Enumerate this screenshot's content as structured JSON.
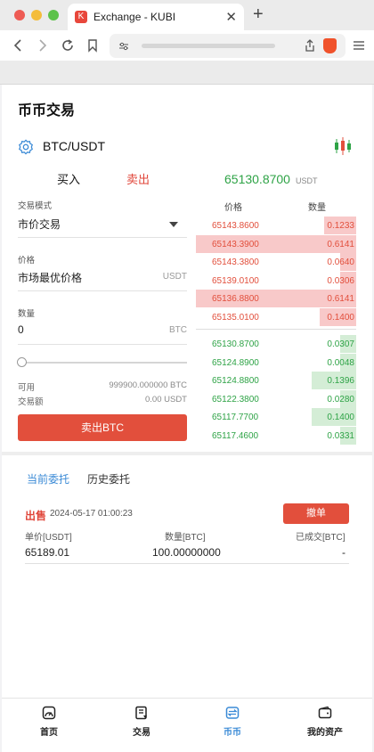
{
  "browser": {
    "tab_title": "Exchange - KUBI",
    "tab_close": "✕",
    "new_tab": "+"
  },
  "page": {
    "title": "币币交易",
    "pair": "BTC/USDT",
    "buy_tab": "买入",
    "sell_tab": "卖出"
  },
  "form": {
    "mode_label": "交易模式",
    "mode_value": "市价交易",
    "price_label": "价格",
    "price_value": "市场最优价格",
    "price_unit": "USDT",
    "qty_label": "数量",
    "qty_value": "0",
    "qty_unit": "BTC",
    "slider_percent": 0,
    "available_label": "可用",
    "available_value": "999900.000000 BTC",
    "volume_label": "交易额",
    "volume_value": "0.00 USDT",
    "sell_button": "卖出BTC"
  },
  "orderbook": {
    "last_price": "65130.8700",
    "last_unit": "USDT",
    "price_header": "价格",
    "qty_header": "数量",
    "asks": [
      {
        "price": "65143.8600",
        "qty": "0.1233",
        "depth": 0.2
      },
      {
        "price": "65143.3900",
        "qty": "0.6141",
        "depth": 1.0
      },
      {
        "price": "65143.3800",
        "qty": "0.0640",
        "depth": 0.1
      },
      {
        "price": "65139.0100",
        "qty": "0.0306",
        "depth": 0.1
      },
      {
        "price": "65136.8800",
        "qty": "0.6141",
        "depth": 1.0
      },
      {
        "price": "65135.0100",
        "qty": "0.1400",
        "depth": 0.23
      }
    ],
    "bids": [
      {
        "price": "65130.8700",
        "qty": "0.0307",
        "depth": 0.1
      },
      {
        "price": "65124.8900",
        "qty": "0.0048",
        "depth": 0.1
      },
      {
        "price": "65124.8800",
        "qty": "0.1396",
        "depth": 0.28
      },
      {
        "price": "65122.3800",
        "qty": "0.0280",
        "depth": 0.1
      },
      {
        "price": "65117.7700",
        "qty": "0.1400",
        "depth": 0.28
      },
      {
        "price": "65117.4600",
        "qty": "0.0331",
        "depth": 0.1
      }
    ]
  },
  "orders": {
    "current_tab": "当前委托",
    "history_tab": "历史委托",
    "order_type": "出售",
    "order_date": "2024-05-17 01:00:23",
    "cancel_button": "撤单",
    "unit_price_header": "单价[USDT]",
    "qty_header": "数量[BTC]",
    "filled_header": "已成交[BTC]",
    "unit_price": "65189.01",
    "qty": "100.00000000",
    "filled": "-"
  },
  "nav": {
    "home": "首页",
    "trade": "交易",
    "spot": "币币",
    "assets": "我的资产"
  },
  "colors": {
    "red": "#e24f3c",
    "green": "#2ea346",
    "blue": "#3a8ad6",
    "ask_bg": "#f8c9c9",
    "bid_bg": "#d4edd6"
  }
}
